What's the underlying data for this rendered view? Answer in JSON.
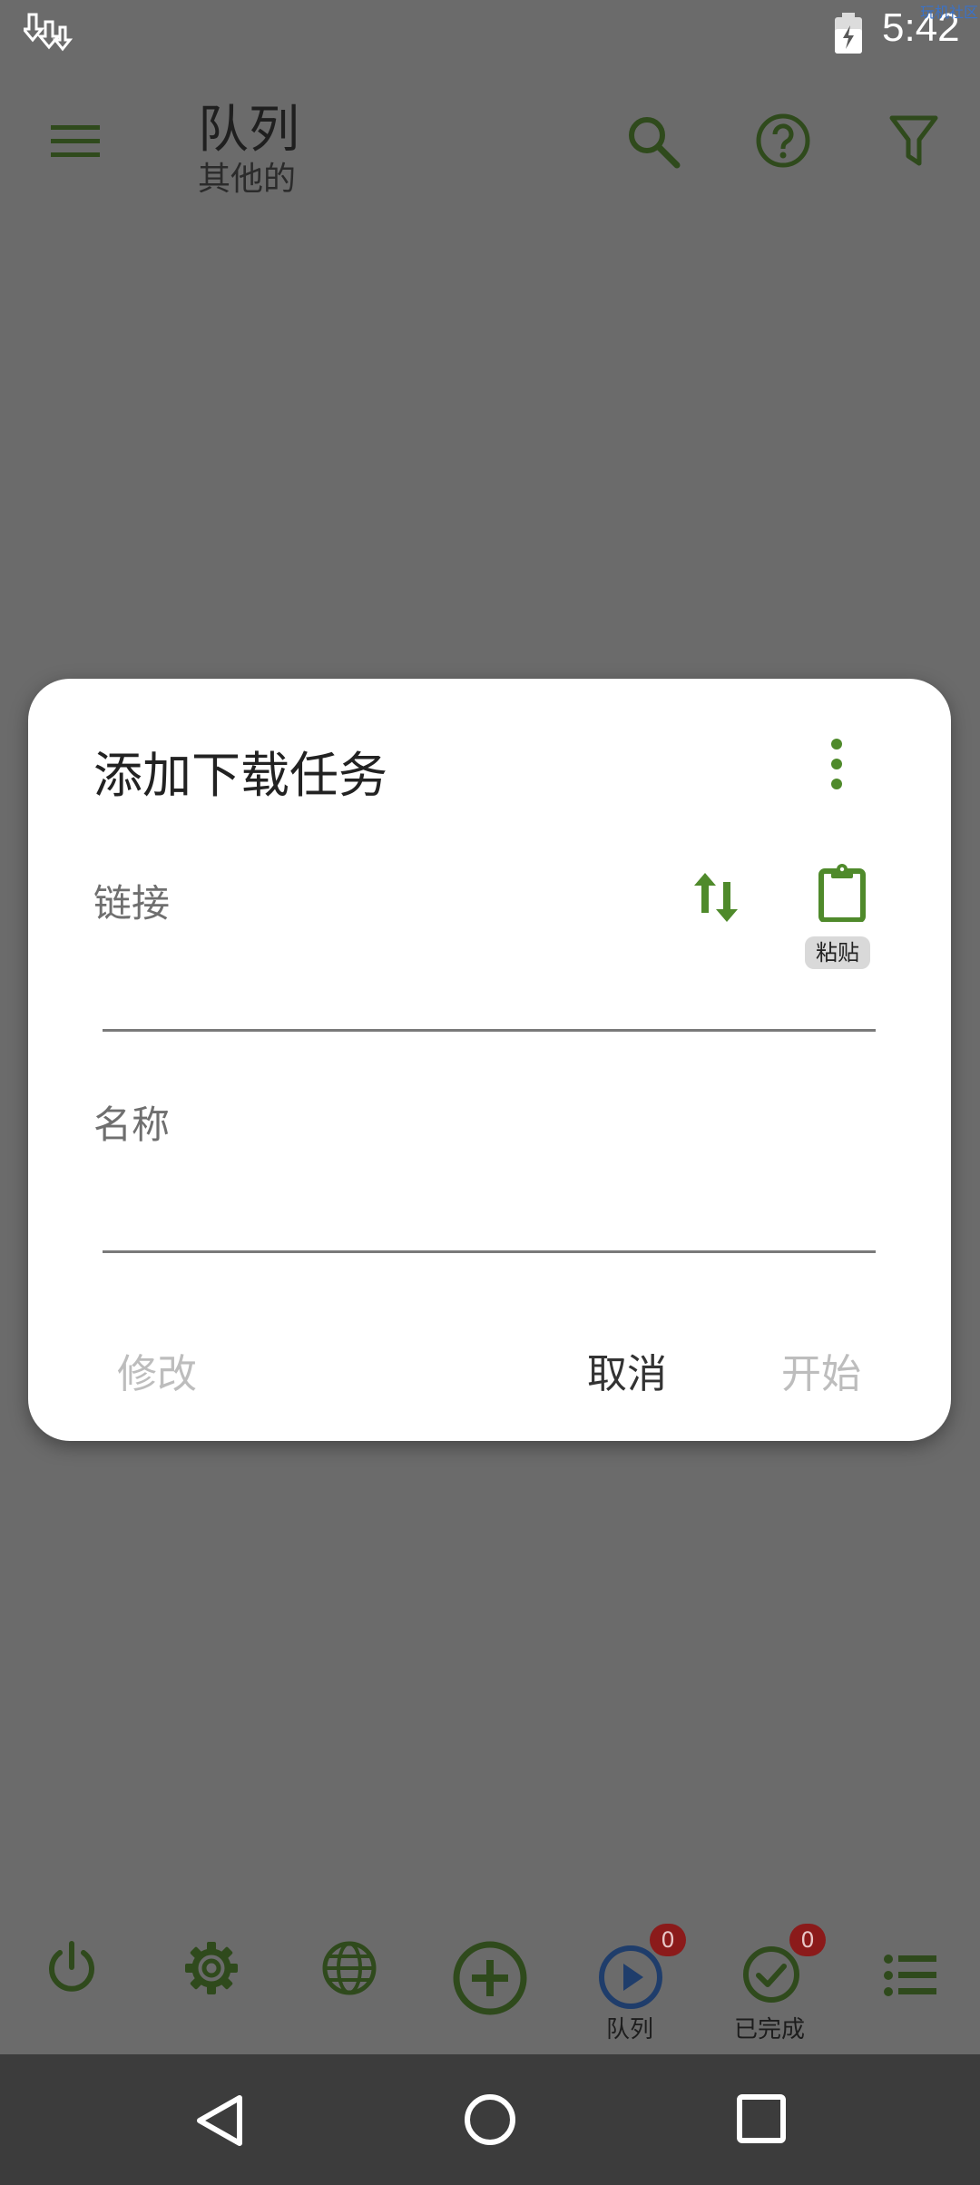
{
  "status_bar": {
    "time": "5:42",
    "watermark": "玩机社区"
  },
  "app_bar": {
    "title": "队列",
    "subtitle": "其他的"
  },
  "dialog": {
    "title": "添加下载任务",
    "link_label": "链接",
    "paste_label": "粘贴",
    "name_label": "名称",
    "modify_label": "修改",
    "cancel_label": "取消",
    "start_label": "开始"
  },
  "bottom_bar": {
    "queue_label": "队列",
    "queue_badge": "0",
    "completed_label": "已完成",
    "completed_badge": "0"
  },
  "colors": {
    "accent_green": "#4f8a2b",
    "dark_green": "#2f4a1c",
    "queue_blue": "#1f3d6b",
    "badge_red": "#8b1a1a"
  }
}
